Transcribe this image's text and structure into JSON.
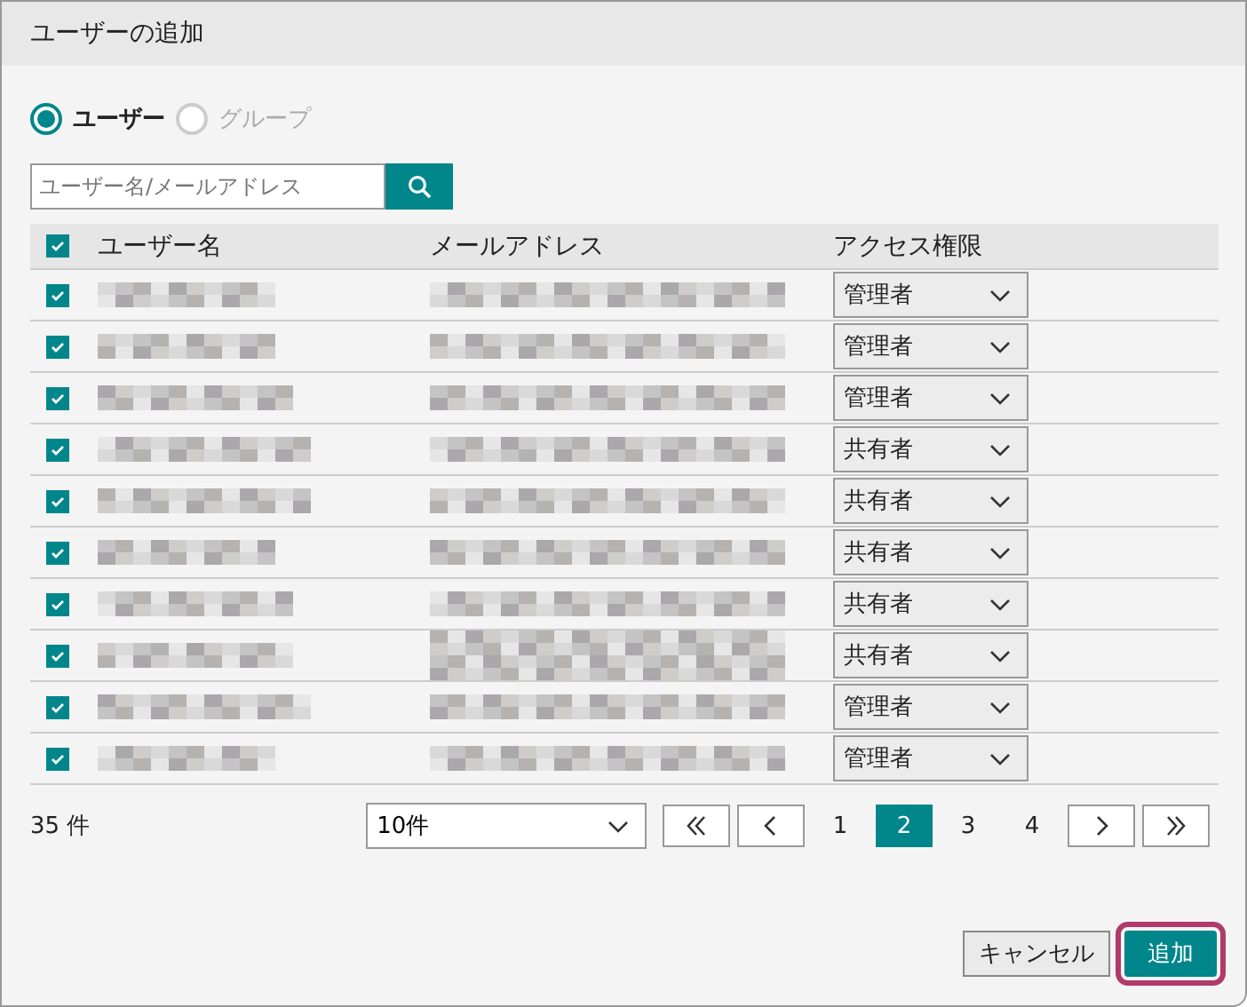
{
  "window": {
    "title": "ユーザーの追加"
  },
  "target_types": [
    {
      "label": "ユーザー",
      "selected": true,
      "disabled": false
    },
    {
      "label": "グループ",
      "selected": false,
      "disabled": true
    }
  ],
  "search": {
    "placeholder": "ユーザー名/メールアドレス"
  },
  "table": {
    "all_checked": true,
    "columns": [
      "ユーザー名",
      "メールアドレス",
      "アクセス権限"
    ],
    "rows": [
      {
        "checked": true,
        "name_blurred": true,
        "email_blurred": true,
        "email_wraps": false,
        "role": "管理者"
      },
      {
        "checked": true,
        "name_blurred": true,
        "email_blurred": true,
        "email_wraps": false,
        "role": "管理者"
      },
      {
        "checked": true,
        "name_blurred": true,
        "email_blurred": true,
        "email_wraps": false,
        "role": "管理者"
      },
      {
        "checked": true,
        "name_blurred": true,
        "email_blurred": true,
        "email_wraps": false,
        "role": "共有者"
      },
      {
        "checked": true,
        "name_blurred": true,
        "email_blurred": true,
        "email_wraps": false,
        "role": "共有者"
      },
      {
        "checked": true,
        "name_blurred": true,
        "email_blurred": true,
        "email_wraps": false,
        "role": "共有者"
      },
      {
        "checked": true,
        "name_blurred": true,
        "email_blurred": true,
        "email_wraps": false,
        "role": "共有者"
      },
      {
        "checked": true,
        "name_blurred": true,
        "email_blurred": true,
        "email_wraps": true,
        "role": "共有者"
      },
      {
        "checked": true,
        "name_blurred": true,
        "email_blurred": true,
        "email_wraps": false,
        "role": "管理者"
      },
      {
        "checked": true,
        "name_blurred": true,
        "email_blurred": true,
        "email_wraps": false,
        "role": "管理者"
      }
    ]
  },
  "footer": {
    "count": "35 件",
    "page_size": "10件",
    "pages": [
      {
        "label": "1",
        "selected": false
      },
      {
        "label": "2",
        "selected": true
      },
      {
        "label": "3",
        "selected": false
      },
      {
        "label": "4",
        "selected": false
      }
    ]
  },
  "buttons": [
    {
      "label": "キャンセル",
      "kind": "secondary",
      "highlighted": false
    },
    {
      "label": "追加",
      "kind": "primary",
      "highlighted": true
    }
  ]
}
